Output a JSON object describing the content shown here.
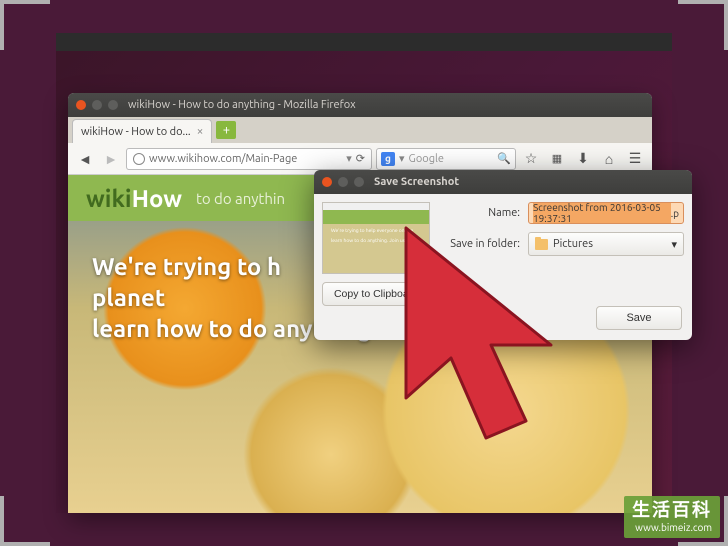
{
  "firefox": {
    "window_title": "wikiHow - How to do anything - Mozilla Firefox",
    "tab_label": "wikiHow - How to do...",
    "url": "www.wikihow.com/Main-Page",
    "search_placeholder": "Google",
    "nav_icons": {
      "back": "back-icon",
      "forward": "forward-icon",
      "reload": "reload-icon",
      "refresh_alt": "refresh-icon",
      "search": "search-icon",
      "star": "star-icon",
      "grid": "apps-icon",
      "download": "download-icon",
      "home": "home-icon",
      "menu": "menu-icon"
    }
  },
  "wikihow": {
    "logo_a": "wiki",
    "logo_b": "How",
    "tagline": "to do anythin",
    "hero_l1": "We're trying to h",
    "hero_l2": "planet",
    "hero_l3": "learn how to do anything."
  },
  "dialog": {
    "title": "Save Screenshot",
    "name_label": "Name:",
    "name_value": "Screenshot from 2016-03-05 19:37:31",
    "name_ext": ".p",
    "folder_label": "Save in folder:",
    "folder_value": "Pictures",
    "copy_btn": "Copy to Clipboard",
    "save_btn": "Save"
  },
  "watermark": {
    "title": "生活百科",
    "url": "www.bimeiz.com"
  }
}
